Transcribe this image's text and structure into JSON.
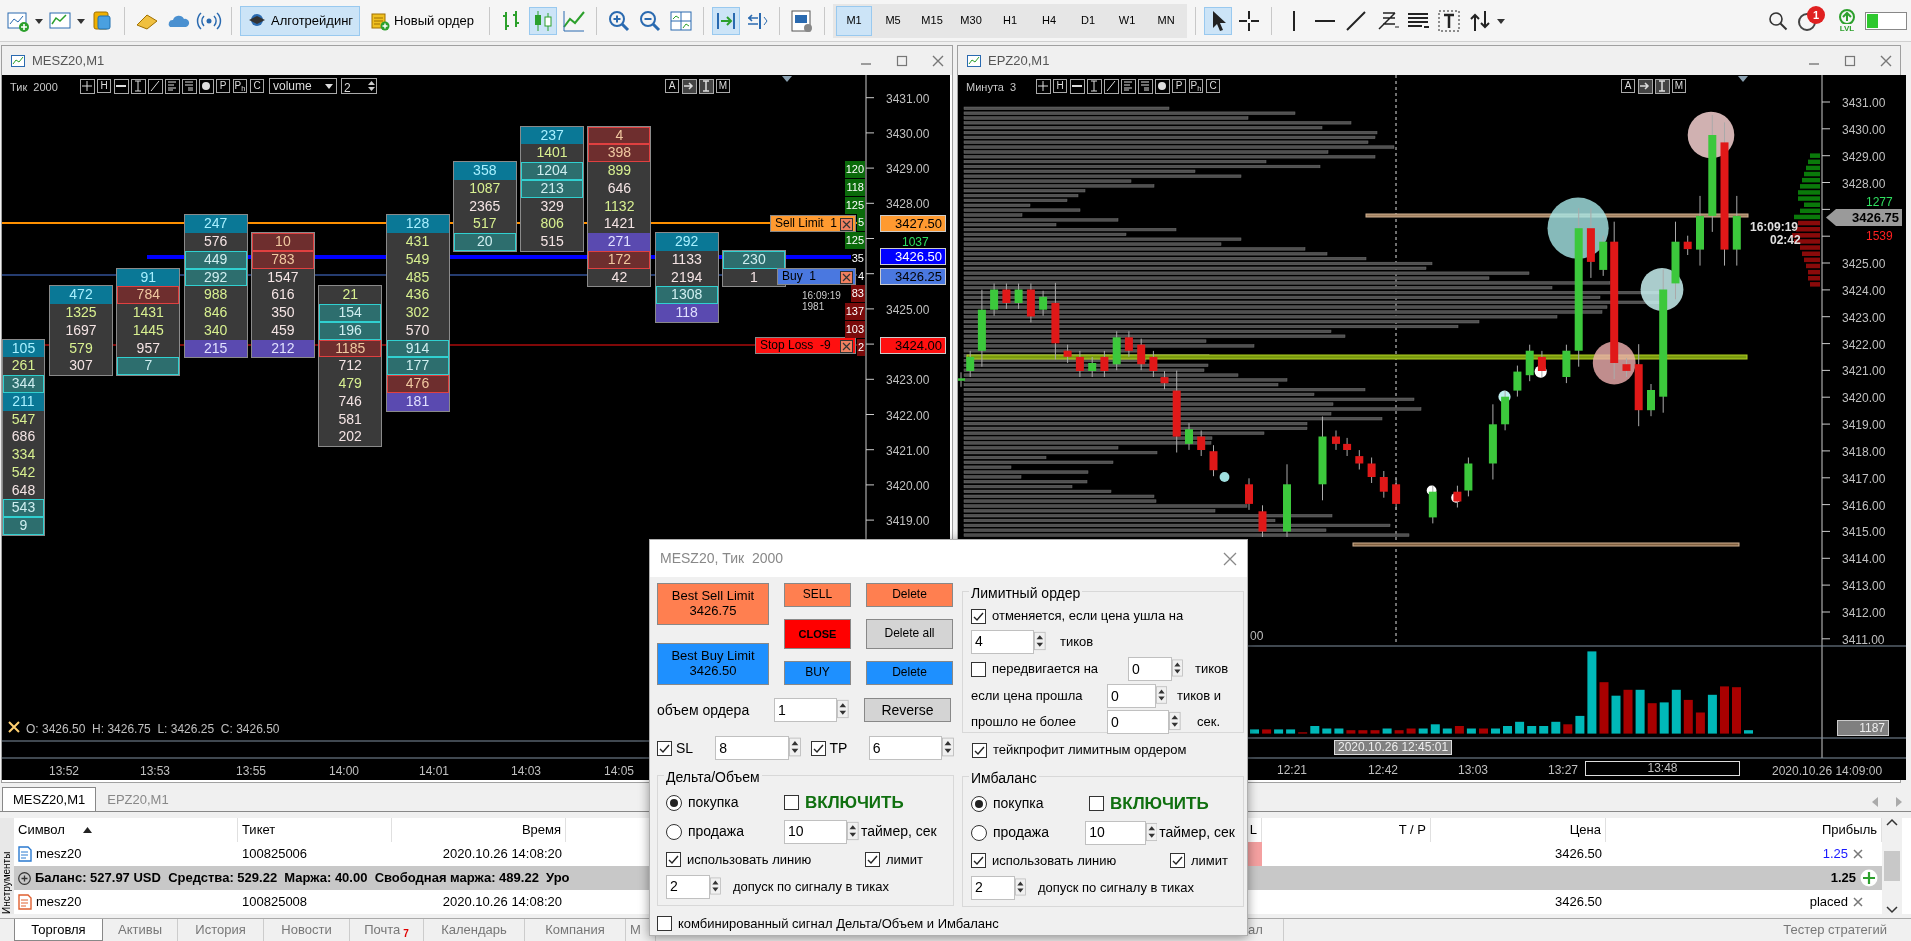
{
  "toolbar": {
    "buttons": [
      {
        "label": "Алготрейдинг",
        "selected": true
      },
      {
        "label": "Новый ордер",
        "selected": false
      }
    ],
    "chart_types": [
      {
        "selected": false
      },
      {
        "selected": true
      },
      {
        "selected": false
      }
    ],
    "autoscroll": {
      "on": true
    },
    "chart_shift": {
      "on": false
    },
    "timeframes": [
      {
        "label": "M1",
        "selected": true
      },
      {
        "label": "M5",
        "selected": false
      },
      {
        "label": "M15",
        "selected": false
      },
      {
        "label": "M30",
        "selected": false
      },
      {
        "label": "H1",
        "selected": false
      },
      {
        "label": "H4",
        "selected": false
      },
      {
        "label": "D1",
        "selected": false
      },
      {
        "label": "W1",
        "selected": false
      },
      {
        "label": "MN",
        "selected": false
      }
    ],
    "pointer_tools": [
      {
        "selected": true
      },
      {
        "selected": false
      }
    ],
    "notification_count": "1",
    "level_badge": "LVL"
  },
  "left_chart": {
    "title": "MESZ20,M1",
    "caption": "Тик  2000",
    "letter_buttons": [
      "H",
      "P",
      "P$_{h}$",
      "C"
    ],
    "right_letter_buttons": [
      "A",
      "M"
    ],
    "indicator": "volume",
    "indicator_param": "2",
    "price_axis": [
      "3431.00",
      "3430.00",
      "3429.00",
      "3428.00",
      "3425.00",
      "3423.00",
      "3422.00",
      "3421.00",
      "3420.00",
      "3419.00"
    ],
    "time_axis": [
      "13:52",
      "13:53",
      "13:55",
      "14:00",
      "14:01",
      "14:03",
      "14:05"
    ],
    "ohlc": "O: 3426.50  H: 3426.75  L: 3426.25  C: 3426.50",
    "clusters": [
      {
        "cells": [
          {
            "text": "105",
            "kind": "head"
          },
          {
            "text": "261",
            "kind": "up"
          },
          {
            "text": "344",
            "kind": "buy"
          },
          {
            "text": "211",
            "kind": "head"
          },
          {
            "text": "547",
            "kind": "up"
          },
          {
            "text": "686",
            "kind": "down"
          },
          {
            "text": "334",
            "kind": "up"
          },
          {
            "text": "542",
            "kind": "up"
          },
          {
            "text": "648",
            "kind": "down"
          },
          {
            "text": "543",
            "kind": "buy"
          },
          {
            "text": "9",
            "kind": "buy"
          }
        ]
      },
      {
        "cells": [
          {
            "text": "472",
            "kind": "head"
          },
          {
            "text": "1325",
            "kind": "up"
          },
          {
            "text": "1697",
            "kind": "down"
          },
          {
            "text": "579",
            "kind": "up"
          },
          {
            "text": "307",
            "kind": "down"
          }
        ]
      },
      {
        "cells": [
          {
            "text": "91",
            "kind": "head"
          },
          {
            "text": "784",
            "kind": "sell"
          },
          {
            "text": "1431",
            "kind": "up"
          },
          {
            "text": "1445",
            "kind": "up"
          },
          {
            "text": "957",
            "kind": "down"
          },
          {
            "text": "7",
            "kind": "buy"
          }
        ]
      },
      {
        "cells": [
          {
            "text": "247",
            "kind": "head"
          },
          {
            "text": "576",
            "kind": "down"
          },
          {
            "text": "449",
            "kind": "buy"
          },
          {
            "text": "292",
            "kind": "buy"
          },
          {
            "text": "988",
            "kind": "up"
          },
          {
            "text": "846",
            "kind": "up"
          },
          {
            "text": "340",
            "kind": "up"
          },
          {
            "text": "215",
            "kind": "vol"
          }
        ]
      },
      {
        "cells": [
          {
            "text": "10",
            "kind": "sell"
          },
          {
            "text": "783",
            "kind": "sell"
          },
          {
            "text": "1547",
            "kind": "down"
          },
          {
            "text": "616",
            "kind": "down"
          },
          {
            "text": "350",
            "kind": "down"
          },
          {
            "text": "459",
            "kind": "down"
          },
          {
            "text": "212",
            "kind": "vol"
          }
        ]
      },
      {
        "cells": [
          {
            "text": "21",
            "kind": "up"
          },
          {
            "text": "154",
            "kind": "buy"
          },
          {
            "text": "196",
            "kind": "buy"
          },
          {
            "text": "1185",
            "kind": "sell"
          },
          {
            "text": "712",
            "kind": "down"
          },
          {
            "text": "479",
            "kind": "up"
          },
          {
            "text": "746",
            "kind": "down"
          },
          {
            "text": "581",
            "kind": "down"
          },
          {
            "text": "202",
            "kind": "down"
          }
        ]
      },
      {
        "cells": [
          {
            "text": "128",
            "kind": "head"
          },
          {
            "text": "431",
            "kind": "up"
          },
          {
            "text": "549",
            "kind": "up"
          },
          {
            "text": "485",
            "kind": "up"
          },
          {
            "text": "436",
            "kind": "up"
          },
          {
            "text": "302",
            "kind": "up"
          },
          {
            "text": "570",
            "kind": "down"
          },
          {
            "text": "914",
            "kind": "buy"
          },
          {
            "text": "177",
            "kind": "buy"
          },
          {
            "text": "476",
            "kind": "sell"
          },
          {
            "text": "181",
            "kind": "vol"
          }
        ]
      },
      {
        "cells": [
          {
            "text": "358",
            "kind": "head"
          },
          {
            "text": "1087",
            "kind": "up"
          },
          {
            "text": "2365",
            "kind": "down"
          },
          {
            "text": "517",
            "kind": "up"
          },
          {
            "text": "20",
            "kind": "buy"
          }
        ]
      },
      {
        "cells": [
          {
            "text": "237",
            "kind": "head"
          },
          {
            "text": "1401",
            "kind": "up"
          },
          {
            "text": "1204",
            "kind": "buy"
          },
          {
            "text": "213",
            "kind": "buy"
          },
          {
            "text": "329",
            "kind": "down"
          },
          {
            "text": "806",
            "kind": "up"
          },
          {
            "text": "515",
            "kind": "down"
          }
        ]
      },
      {
        "cells": [
          {
            "text": "4",
            "kind": "sell"
          },
          {
            "text": "398",
            "kind": "sell"
          },
          {
            "text": "899",
            "kind": "up"
          },
          {
            "text": "646",
            "kind": "down"
          },
          {
            "text": "1132",
            "kind": "up"
          },
          {
            "text": "1421",
            "kind": "down"
          },
          {
            "text": "271",
            "kind": "vol"
          },
          {
            "text": "172",
            "kind": "sell"
          },
          {
            "text": "42",
            "kind": "down"
          }
        ]
      },
      {
        "cells": [
          {
            "text": "292",
            "kind": "head"
          },
          {
            "text": "1133",
            "kind": "down"
          },
          {
            "text": "2194",
            "kind": "down"
          },
          {
            "text": "1308",
            "kind": "buy"
          },
          {
            "text": "118",
            "kind": "vol"
          }
        ]
      },
      {
        "cells": [
          {
            "text": "230",
            "kind": "buy"
          },
          {
            "text": "1",
            "kind": "down"
          }
        ]
      }
    ],
    "delta_column": [
      {
        "text": "120",
        "kind": "buy"
      },
      {
        "text": "118",
        "kind": "buy"
      },
      {
        "text": "125",
        "kind": "buy"
      },
      {
        "text": "5",
        "kind": "buy"
      },
      {
        "text": "125",
        "kind": "buy"
      },
      {
        "text": "35",
        "kind": "neutral"
      },
      {
        "text": "4",
        "kind": "neutral"
      },
      {
        "text": "83",
        "kind": "sell"
      },
      {
        "text": "137",
        "kind": "sell"
      },
      {
        "text": "103",
        "kind": "sell"
      },
      {
        "text": "2",
        "kind": "sell"
      }
    ],
    "delta_total": "1037",
    "order_labels": [
      {
        "text": "Sell Limit  1",
        "kind": "sell_limit"
      },
      {
        "text": "Buy  1",
        "kind": "buy_limit"
      },
      {
        "text": "Stop Loss  -9",
        "kind": "stop_loss"
      }
    ],
    "price_tags": [
      {
        "text": "3427.50",
        "kind": "sell_limit"
      },
      {
        "text": "3426.50",
        "kind": "bid"
      },
      {
        "text": "3426.25",
        "kind": "buy_limit"
      },
      {
        "text": "3424.00",
        "kind": "stop_loss"
      }
    ],
    "timer": [
      "16:09:19",
      "1981"
    ]
  },
  "right_chart": {
    "title": "EPZ20,M1",
    "caption": "Минута  3",
    "letter_buttons": [
      "H",
      "P",
      "P$_{h}$",
      "C"
    ],
    "right_letter_buttons": [
      "A",
      "M"
    ],
    "price_axis": [
      "3431.00",
      "3430.00",
      "3429.00",
      "3428.00",
      "3425.00",
      "3424.00",
      "3423.00",
      "3422.00",
      "3421.00",
      "3420.00",
      "3419.00",
      "3418.00",
      "3417.00",
      "3416.00",
      "3415.00",
      "3414.00",
      "3413.00",
      "3412.00",
      "3411.00"
    ],
    "price_tag": "3426.75",
    "ask_volume": "1277",
    "bid_volume": "1539",
    "timer": [
      "16:09:19",
      "02:42"
    ],
    "price_fragment": "00",
    "volume_tag": "1187",
    "crosshair_time": "2020.10.26 12:45:01",
    "time_axis": [
      {
        "text": "12:21",
        "boxed": false
      },
      {
        "text": "12:42",
        "boxed": false
      },
      {
        "text": "13:03",
        "boxed": false
      },
      {
        "text": "13:27",
        "boxed": false
      },
      {
        "text": "13:48",
        "boxed": true
      }
    ],
    "last_time": "2020.10.26 14:09:00"
  },
  "order_panel": {
    "title": "MESZ20, Тик  2000",
    "best_sell": {
      "label": "Best Sell Limit",
      "price": "3426.75"
    },
    "best_buy": {
      "label": "Best Buy Limit",
      "price": "3426.50"
    },
    "buttons": [
      {
        "label": "SELL",
        "kind": "sell"
      },
      {
        "label": "Delete",
        "kind": "sell"
      },
      {
        "label": "CLOSE",
        "kind": "close"
      },
      {
        "label": "Delete all",
        "kind": "neutral"
      },
      {
        "label": "BUY",
        "kind": "buy"
      },
      {
        "label": "Delete",
        "kind": "buy"
      }
    ],
    "volume": {
      "label": "объем ордера",
      "value": "1"
    },
    "reverse_button": "Reverse",
    "sl": {
      "label": "SL",
      "checked": true,
      "value": "8"
    },
    "tp": {
      "label": "TP",
      "checked": true,
      "value": "6"
    },
    "limit_order": {
      "title": "Лимитный ордер",
      "cancel": {
        "label": "отменяется, если цена ушла на",
        "checked": true,
        "value": "4",
        "unit": "тиков"
      },
      "move": {
        "label": "передвигается на",
        "checked": false,
        "value": "0",
        "unit": "тиков"
      },
      "if_passed": {
        "label": "если цена прошла",
        "value": "0",
        "unit": "тиков и"
      },
      "within": {
        "label": "прошло не более",
        "value": "0",
        "unit": "сек."
      }
    },
    "take_profit_limit": {
      "label": "тейкпрофит лимитным ордером",
      "checked": true
    },
    "signals": [
      {
        "title": "Дельта/Объем",
        "options": [
          {
            "label": "покупка",
            "selected": true
          },
          {
            "label": "продажа",
            "selected": false
          }
        ],
        "enable": {
          "label": "ВКЛЮЧИТЬ",
          "checked": false
        },
        "timer": {
          "value": "10",
          "label": "таймер, сек"
        },
        "use_line": {
          "label": "использовать линию",
          "checked": true
        },
        "limit": {
          "label": "лимит",
          "checked": true
        },
        "tolerance": {
          "value": "2",
          "label": "допуск по сигналу в тиках"
        }
      },
      {
        "title": "Имбаланс",
        "options": [
          {
            "label": "покупка",
            "selected": true
          },
          {
            "label": "продажа",
            "selected": false
          }
        ],
        "enable": {
          "label": "ВКЛЮЧИТЬ",
          "checked": false
        },
        "timer": {
          "value": "10",
          "label": "таймер, сек"
        },
        "use_line": {
          "label": "использовать линию",
          "checked": true
        },
        "limit": {
          "label": "лимит",
          "checked": true
        },
        "tolerance": {
          "value": "2",
          "label": "допуск по сигналу в тиках"
        }
      }
    ],
    "combined": {
      "label": "комбинированный сигнал Дельта/Объем и Имбаланс",
      "checked": false
    }
  },
  "terminal": {
    "chart_tabs": [
      {
        "label": "MESZ20,M1",
        "selected": true
      },
      {
        "label": "EPZ20,M1",
        "selected": false
      }
    ],
    "side_label": "Инструменты",
    "columns": [
      {
        "label": "Символ",
        "sorted": true
      },
      {
        "label": "Тикет",
        "sorted": false
      },
      {
        "label": "Время",
        "sorted": false
      },
      {
        "label": "L",
        "sorted": false
      },
      {
        "label": "T / P",
        "sorted": false
      },
      {
        "label": "Цена",
        "sorted": false
      },
      {
        "label": "Прибыль",
        "sorted": false
      }
    ],
    "rows": [
      {
        "kind": "position",
        "symbol": "mesz20",
        "ticket": "100825006",
        "time": "2020.10.26 14:08:20",
        "price": "3426.50",
        "profit": "1.25"
      },
      {
        "kind": "summary",
        "text": "Баланс: 527.97 USD  Средства: 529.22  Маржа: 40.00  Свободная маржа: 489.22  Уро",
        "profit": "1.25"
      },
      {
        "kind": "order",
        "symbol": "mesz20",
        "ticket": "100825008",
        "time": "2020.10.26 14:08:20",
        "price": "3426.50",
        "profit": "placed"
      }
    ],
    "tabs": [
      {
        "label": "Торговля",
        "selected": true
      },
      {
        "label": "Активы",
        "selected": false
      },
      {
        "label": "История",
        "selected": false
      },
      {
        "label": "Новости",
        "selected": false
      },
      {
        "label": "Почта",
        "badge": "7",
        "selected": false
      },
      {
        "label": "Календарь",
        "selected": false
      },
      {
        "label": "Компания",
        "selected": false
      },
      {
        "label": "М",
        "selected": false
      },
      {
        "label": "ал",
        "selected": false
      },
      {
        "label": "Тестер стратегий",
        "selected": false
      }
    ]
  }
}
